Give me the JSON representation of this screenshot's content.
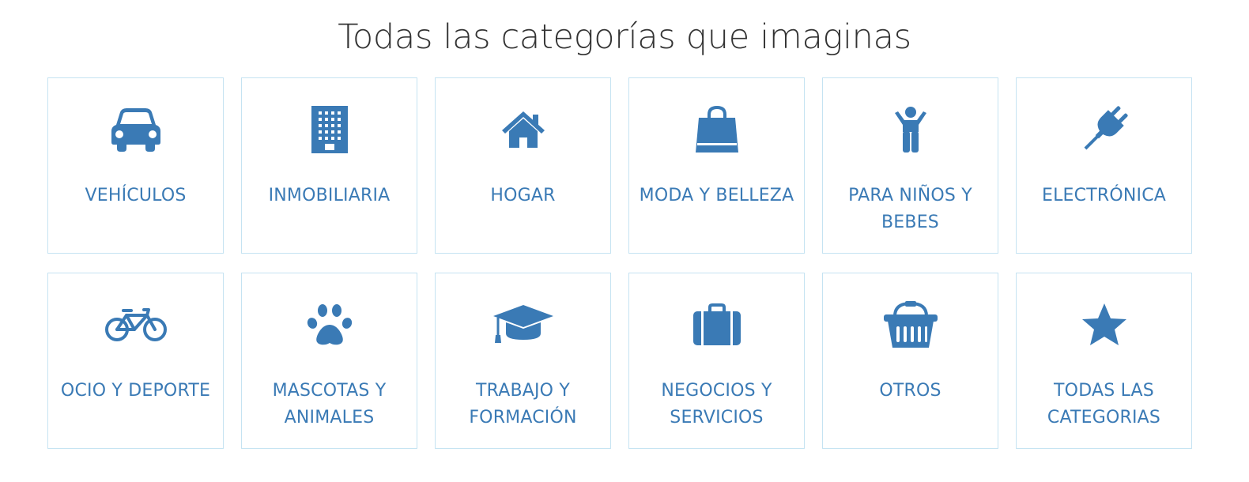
{
  "title": "Todas las categorías que imaginas",
  "accent_color": "#3a7ab5",
  "border_color": "#c5e3f2",
  "categories": [
    {
      "label": "VEHÍCULOS",
      "icon": "car-icon"
    },
    {
      "label": "INMOBILIARIA",
      "icon": "building-icon"
    },
    {
      "label": "HOGAR",
      "icon": "home-icon"
    },
    {
      "label": "MODA Y BELLEZA",
      "icon": "shopping-bag-icon"
    },
    {
      "label": "PARA NIÑOS Y BEBES",
      "icon": "child-icon"
    },
    {
      "label": "ELECTRÓNICA",
      "icon": "plug-icon"
    },
    {
      "label": "OCIO Y DEPORTE",
      "icon": "bicycle-icon"
    },
    {
      "label": "MASCOTAS Y ANIMALES",
      "icon": "paw-icon"
    },
    {
      "label": "TRABAJO Y FORMACIÓN",
      "icon": "graduation-cap-icon"
    },
    {
      "label": "NEGOCIOS Y SERVICIOS",
      "icon": "briefcase-icon"
    },
    {
      "label": "OTROS",
      "icon": "basket-icon"
    },
    {
      "label": "TODAS LAS CATEGORIAS",
      "icon": "star-icon"
    }
  ]
}
